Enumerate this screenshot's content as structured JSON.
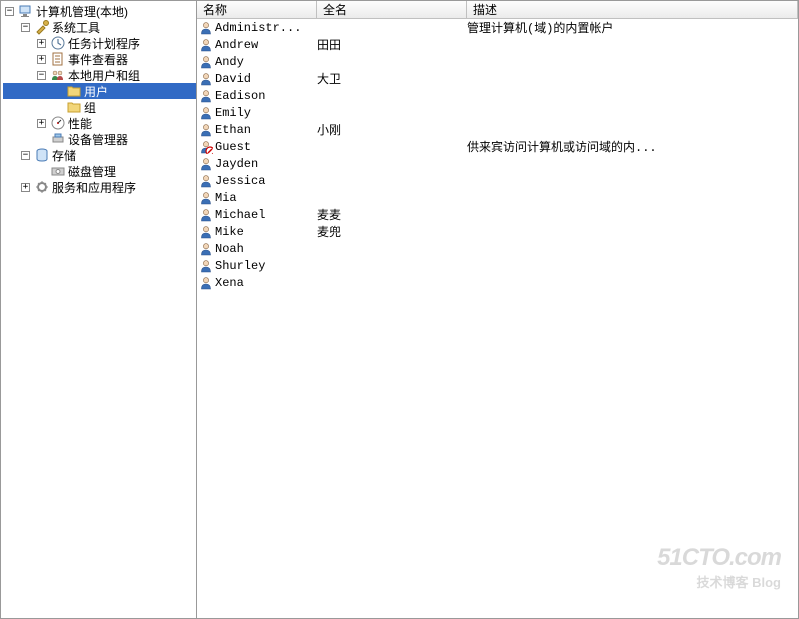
{
  "tree": {
    "root": {
      "label": "计算机管理(本地)",
      "expanded": true,
      "icon": "computer-icon",
      "children": [
        {
          "label": "系统工具",
          "expanded": true,
          "icon": "tools-icon",
          "children": [
            {
              "label": "任务计划程序",
              "icon": "schedule-icon",
              "expandable": true
            },
            {
              "label": "事件查看器",
              "icon": "event-icon",
              "expandable": true
            },
            {
              "label": "本地用户和组",
              "icon": "users-group-icon",
              "expanded": true,
              "children": [
                {
                  "label": "用户",
                  "icon": "folder-icon",
                  "selected": true
                },
                {
                  "label": "组",
                  "icon": "folder-icon"
                }
              ]
            },
            {
              "label": "性能",
              "icon": "perf-icon",
              "expandable": true
            },
            {
              "label": "设备管理器",
              "icon": "device-icon"
            }
          ]
        },
        {
          "label": "存储",
          "expanded": true,
          "icon": "storage-icon",
          "children": [
            {
              "label": "磁盘管理",
              "icon": "disk-icon"
            }
          ]
        },
        {
          "label": "服务和应用程序",
          "icon": "services-icon",
          "expandable": true
        }
      ]
    }
  },
  "columns": {
    "name": "名称",
    "fullname": "全名",
    "description": "描述"
  },
  "users": [
    {
      "name": "Administr...",
      "fullname": "",
      "description": "管理计算机(域)的内置帐户",
      "disabled": false
    },
    {
      "name": "Andrew",
      "fullname": "田田",
      "description": "",
      "disabled": false
    },
    {
      "name": "Andy",
      "fullname": "",
      "description": "",
      "disabled": false
    },
    {
      "name": "David",
      "fullname": "大卫",
      "description": "",
      "disabled": false
    },
    {
      "name": "Eadison",
      "fullname": "",
      "description": "",
      "disabled": false
    },
    {
      "name": "Emily",
      "fullname": "",
      "description": "",
      "disabled": false
    },
    {
      "name": "Ethan",
      "fullname": "小刚",
      "description": "",
      "disabled": false
    },
    {
      "name": "Guest",
      "fullname": "",
      "description": "供来宾访问计算机或访问域的内...",
      "disabled": true
    },
    {
      "name": "Jayden",
      "fullname": "",
      "description": "",
      "disabled": false
    },
    {
      "name": "Jessica",
      "fullname": "",
      "description": "",
      "disabled": false
    },
    {
      "name": "Mia",
      "fullname": "",
      "description": "",
      "disabled": false
    },
    {
      "name": "Michael",
      "fullname": "麦麦",
      "description": "",
      "disabled": false
    },
    {
      "name": "Mike",
      "fullname": "麦兜",
      "description": "",
      "disabled": false
    },
    {
      "name": "Noah",
      "fullname": "",
      "description": "",
      "disabled": false
    },
    {
      "name": "Shurley",
      "fullname": "",
      "description": "",
      "disabled": false
    },
    {
      "name": "Xena",
      "fullname": "",
      "description": "",
      "disabled": false
    }
  ],
  "watermark": {
    "big": "51CTO.com",
    "small": "技术博客  Blog"
  }
}
